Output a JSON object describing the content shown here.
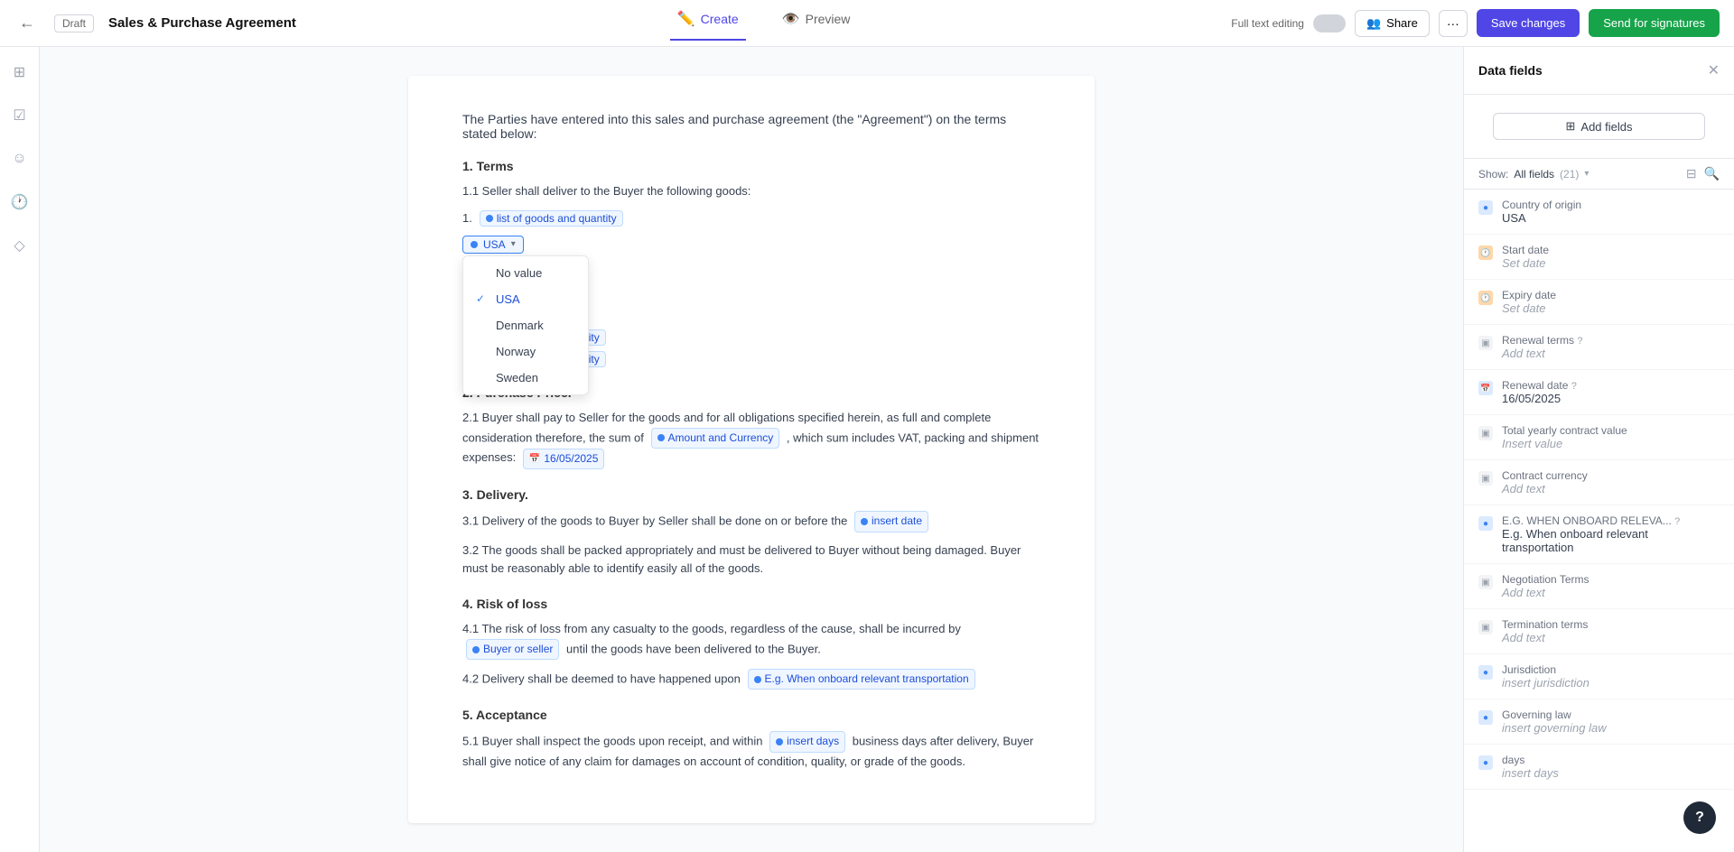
{
  "topbar": {
    "draft_label": "Draft",
    "doc_title": "Sales & Purchase Agreement",
    "tabs": [
      {
        "id": "create",
        "label": "Create",
        "icon": "✏️",
        "active": true
      },
      {
        "id": "preview",
        "label": "Preview",
        "icon": "👁️",
        "active": false
      }
    ],
    "full_text_label": "Full text editing",
    "share_label": "Share",
    "save_label": "Save changes",
    "send_label": "Send for signatures"
  },
  "document": {
    "intro": "The Parties have entered into this sales and purchase agreement (the \"Agreement\") on the terms stated below:",
    "section1_title": "1. Terms",
    "section1_1": "1.1 Seller shall deliver to the Buyer the following goods:",
    "list_item1_num": "1.",
    "list_item1_chip": "list of goods and quantity",
    "country_selected": "USA",
    "list_item2_chip": "list of goods and quantity",
    "list_item3_chip": "list of goods and quantity",
    "section2_title": "2. Purchase Price.",
    "section2_1_pre": "2.1 Buyer shall pay to Seller for the goods and for all obligations specified herein, as full and complete consideration therefore, the sum of",
    "amount_chip": "Amount and Currency",
    "section2_1_mid": ", which sum includes VAT, packing and shipment expenses:",
    "date_chip1": "16/05/2025",
    "section3_title": "3. Delivery.",
    "section3_1_pre": "3.1 Delivery of the goods to Buyer by Seller shall be done on or before the",
    "insert_date_chip": "insert date",
    "section3_2": "3.2 The goods shall be packed appropriately and must be delivered to Buyer without being damaged. Buyer must be reasonably able to identify easily all of the goods.",
    "section4_title": "4. Risk of loss",
    "section4_1_pre": "4.1 The risk of loss from any casualty to the goods, regardless of the cause, shall be incurred by",
    "buyer_seller_chip": "Buyer or seller",
    "section4_1_post": "until the goods have been delivered to the Buyer.",
    "section4_2_pre": "4.2 Delivery shall be deemed to have happened upon",
    "onboard_chip": "E.g. When onboard relevant transportation",
    "section5_title": "5. Acceptance",
    "section5_1_pre": "5.1 Buyer shall inspect the goods upon receipt, and within",
    "days_chip": "insert days",
    "section5_1_post": "business days after delivery, Buyer shall give notice of any claim for damages on account of condition, quality, or grade of the goods.",
    "dropdown_options": [
      {
        "id": "no-value",
        "label": "No value",
        "selected": false
      },
      {
        "id": "usa",
        "label": "USA",
        "selected": true
      },
      {
        "id": "denmark",
        "label": "Denmark",
        "selected": false
      },
      {
        "id": "norway",
        "label": "Norway",
        "selected": false
      },
      {
        "id": "sweden",
        "label": "Sweden",
        "selected": false
      }
    ]
  },
  "sidebar": {
    "title": "Data fields",
    "add_fields_label": "Add fields",
    "show_label": "Show:",
    "show_value": "All fields",
    "show_count": "(21)",
    "fields": [
      {
        "id": "country-of-origin",
        "icon_type": "blue",
        "icon_char": "●",
        "name": "Country of origin",
        "value": "USA",
        "is_placeholder": false
      },
      {
        "id": "start-date",
        "icon_type": "orange",
        "icon_char": "🕐",
        "name": "Start date",
        "value": "Set date",
        "is_placeholder": true
      },
      {
        "id": "expiry-date",
        "icon_type": "orange",
        "icon_char": "🕐",
        "name": "Expiry date",
        "value": "Set date",
        "is_placeholder": true
      },
      {
        "id": "renewal-terms",
        "icon_type": "gray",
        "icon_char": "▣",
        "name": "Renewal terms",
        "value": "Add text",
        "has_help": true,
        "is_placeholder": true
      },
      {
        "id": "renewal-date",
        "icon_type": "blue",
        "icon_char": "📅",
        "name": "Renewal date",
        "value": "16/05/2025",
        "has_help": true,
        "is_placeholder": false
      },
      {
        "id": "total-yearly",
        "icon_type": "gray",
        "icon_char": "▣",
        "name": "Total yearly contract value",
        "value": "Insert value",
        "is_placeholder": true
      },
      {
        "id": "contract-currency",
        "icon_type": "gray",
        "icon_char": "▣",
        "name": "Contract currency",
        "value": "Add text",
        "is_placeholder": true
      },
      {
        "id": "eg-onboard",
        "icon_type": "blue",
        "icon_char": "●",
        "name": "E.G. WHEN ONBOARD RELEVA...",
        "value": "E.g. When onboard relevant transportation",
        "has_help": true,
        "is_placeholder": false
      },
      {
        "id": "negotiation-terms",
        "icon_type": "gray",
        "icon_char": "▣",
        "name": "Negotiation Terms",
        "value": "Add text",
        "is_placeholder": true
      },
      {
        "id": "termination-terms",
        "icon_type": "gray",
        "icon_char": "▣",
        "name": "Termination terms",
        "value": "Add text",
        "is_placeholder": true
      },
      {
        "id": "jurisdiction",
        "icon_type": "blue",
        "icon_char": "●",
        "name": "Jurisdiction",
        "value": "insert jurisdiction",
        "is_placeholder": true
      },
      {
        "id": "governing-law",
        "icon_type": "blue",
        "icon_char": "●",
        "name": "Governing law",
        "value": "insert governing law",
        "is_placeholder": true
      },
      {
        "id": "days",
        "icon_type": "blue",
        "icon_char": "●",
        "name": "days",
        "value": "insert days",
        "is_placeholder": true
      }
    ]
  }
}
